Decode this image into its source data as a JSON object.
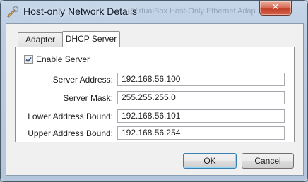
{
  "window": {
    "title": "Host-only Network Details",
    "background_text": "VirtualBox Host-Only Ethernet Adapter",
    "close_glyph": "✕"
  },
  "tabs": [
    {
      "label": "Adapter",
      "selected": false
    },
    {
      "label": "DHCP Server",
      "selected": true
    }
  ],
  "dhcp": {
    "enable_label": "Enable Server",
    "enable_checked": true,
    "fields": [
      {
        "label": "Server Address:",
        "value": "192.168.56.100"
      },
      {
        "label": "Server Mask:",
        "value": "255.255.255.0"
      },
      {
        "label": "Lower Address Bound:",
        "value": "192.168.56.101"
      },
      {
        "label": "Upper Address Bound:",
        "value": "192.168.56.254"
      }
    ]
  },
  "buttons": {
    "ok": "OK",
    "cancel": "Cancel"
  },
  "icons": {
    "title_icon": "wrench-screwdriver-icon",
    "close": "close-icon",
    "checkbox": "checkmark-icon"
  },
  "colors": {
    "close_button": "#c3402a",
    "default_button_border": "#3c7fb1"
  }
}
